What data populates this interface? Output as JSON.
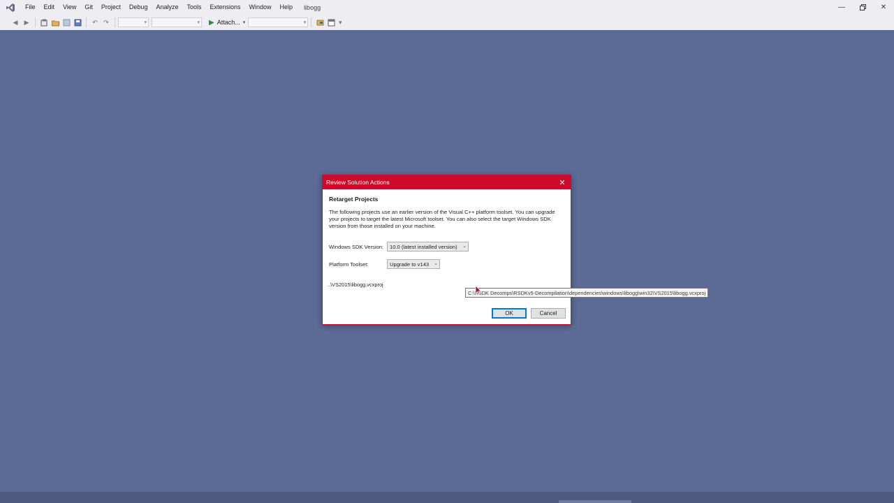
{
  "titlebar": {
    "menus": [
      "File",
      "Edit",
      "View",
      "Git",
      "Project",
      "Debug",
      "Analyze",
      "Tools",
      "Extensions",
      "Window",
      "Help"
    ],
    "solution_name": "libogg"
  },
  "toolbar": {
    "attach_label": "Attach..."
  },
  "dialog": {
    "title": "Review Solution Actions",
    "heading": "Retarget Projects",
    "description": "The following projects use an earlier version of the Visual C++ platform toolset.  You can upgrade your projects to target the latest Microsoft toolset.  You can also select the target Windows SDK version from those installed on your machine.",
    "sdk_label": "Windows SDK Version:",
    "sdk_value": "10.0 (latest installed version)",
    "toolset_label": "Platform Toolset:",
    "toolset_value": "Upgrade to v143",
    "project_path": "..\\VS2015\\libogg.vcxproj",
    "ok_label": "OK",
    "cancel_label": "Cancel"
  },
  "tooltip": {
    "text": "C:\\RSDK Decomps\\RSDKv5-Decompilation\\dependencies\\windows\\libogg\\win32\\VS2015\\libogg.vcxproj"
  },
  "colors": {
    "background": "#5c6a96",
    "dialog_title": "#cc0a2a",
    "chrome": "#eeeef2"
  }
}
